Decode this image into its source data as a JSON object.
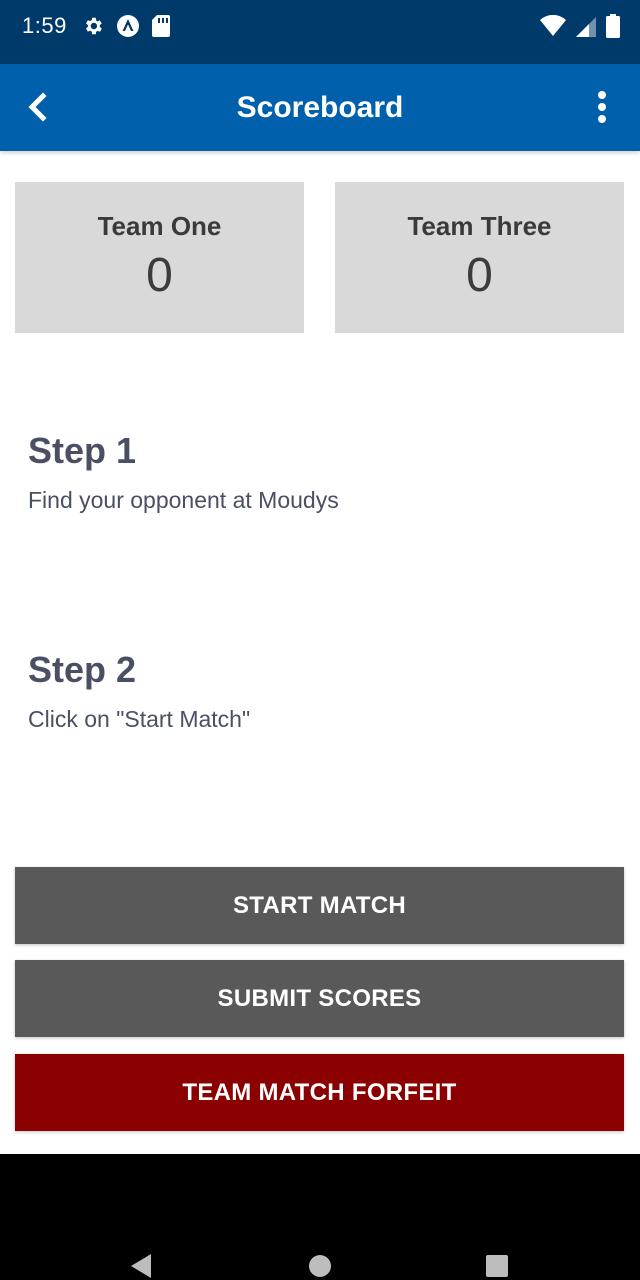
{
  "status_bar": {
    "time": "1:59",
    "left_icons": [
      "gear-icon",
      "app-notification-icon",
      "sd-card-icon"
    ],
    "right_icons": [
      "wifi-icon",
      "cell-signal-icon",
      "battery-icon"
    ]
  },
  "app_bar": {
    "title": "Scoreboard",
    "back_icon": "chevron-left-icon",
    "menu_icon": "more-vertical-icon"
  },
  "teams": [
    {
      "name": "Team One",
      "score": "0"
    },
    {
      "name": "Team Three",
      "score": "0"
    }
  ],
  "steps": [
    {
      "title": "Step 1",
      "description": "Find your opponent at Moudys"
    },
    {
      "title": "Step 2",
      "description": "Click on \"Start Match\""
    }
  ],
  "buttons": {
    "start_match": "START MATCH",
    "submit_scores": "SUBMIT SCORES",
    "forfeit": "TEAM MATCH FORFEIT"
  },
  "colors": {
    "status_bar": "#003a6b",
    "app_bar": "#0060ac",
    "button_gray": "#595959",
    "button_red": "#8b0000",
    "score_card": "#d9d9d9"
  },
  "nav_bar": {
    "icons": [
      "back-triangle-icon",
      "home-circle-icon",
      "recents-square-icon"
    ]
  }
}
